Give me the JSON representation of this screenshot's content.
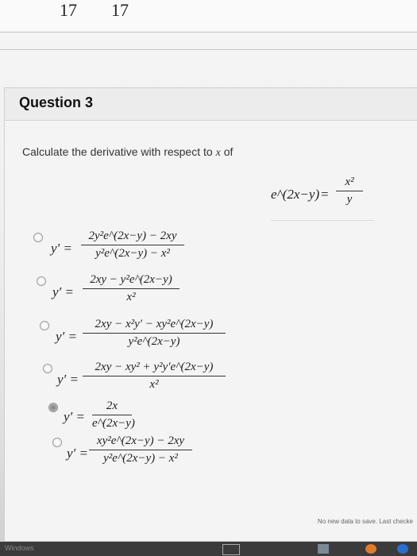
{
  "page_header": {
    "num_left": "17",
    "num_right": "17"
  },
  "question": {
    "title": "Question 3",
    "prompt": "Calculate the derivative with respect to",
    "variable": "x",
    "prompt_suffix": "of",
    "equation": {
      "lhs": "e^(2x−y)",
      "equals": "=",
      "rhs_num": "x²",
      "rhs_den": "y"
    }
  },
  "options": [
    {
      "label": "y′ =",
      "num": "2y²e^(2x−y) − 2xy",
      "den": "y²e^(2x−y) − x²",
      "selected": false
    },
    {
      "label": "y′ =",
      "num": "2xy − y²e^(2x−y)",
      "den": "x²",
      "selected": false
    },
    {
      "label": "y′ =",
      "num": "2xy − x²y′ − xy²e^(2x−y)",
      "den": "y²e^(2x−y)",
      "selected": false
    },
    {
      "label": "y′ =",
      "num": "2xy − xy² + y²y′e^(2x−y)",
      "den": "x²",
      "selected": false
    },
    {
      "label": "y′ =",
      "num": "2x",
      "den": "e^(2x−y)",
      "selected": true
    },
    {
      "label": "y′ =",
      "num": "xy²e^(2x−y) − 2xy",
      "den": "y²e^(2x−y) − x²",
      "selected": false
    }
  ],
  "status_text": "No new data to save. Last checke",
  "taskbar": {
    "start_label": "Windows"
  }
}
